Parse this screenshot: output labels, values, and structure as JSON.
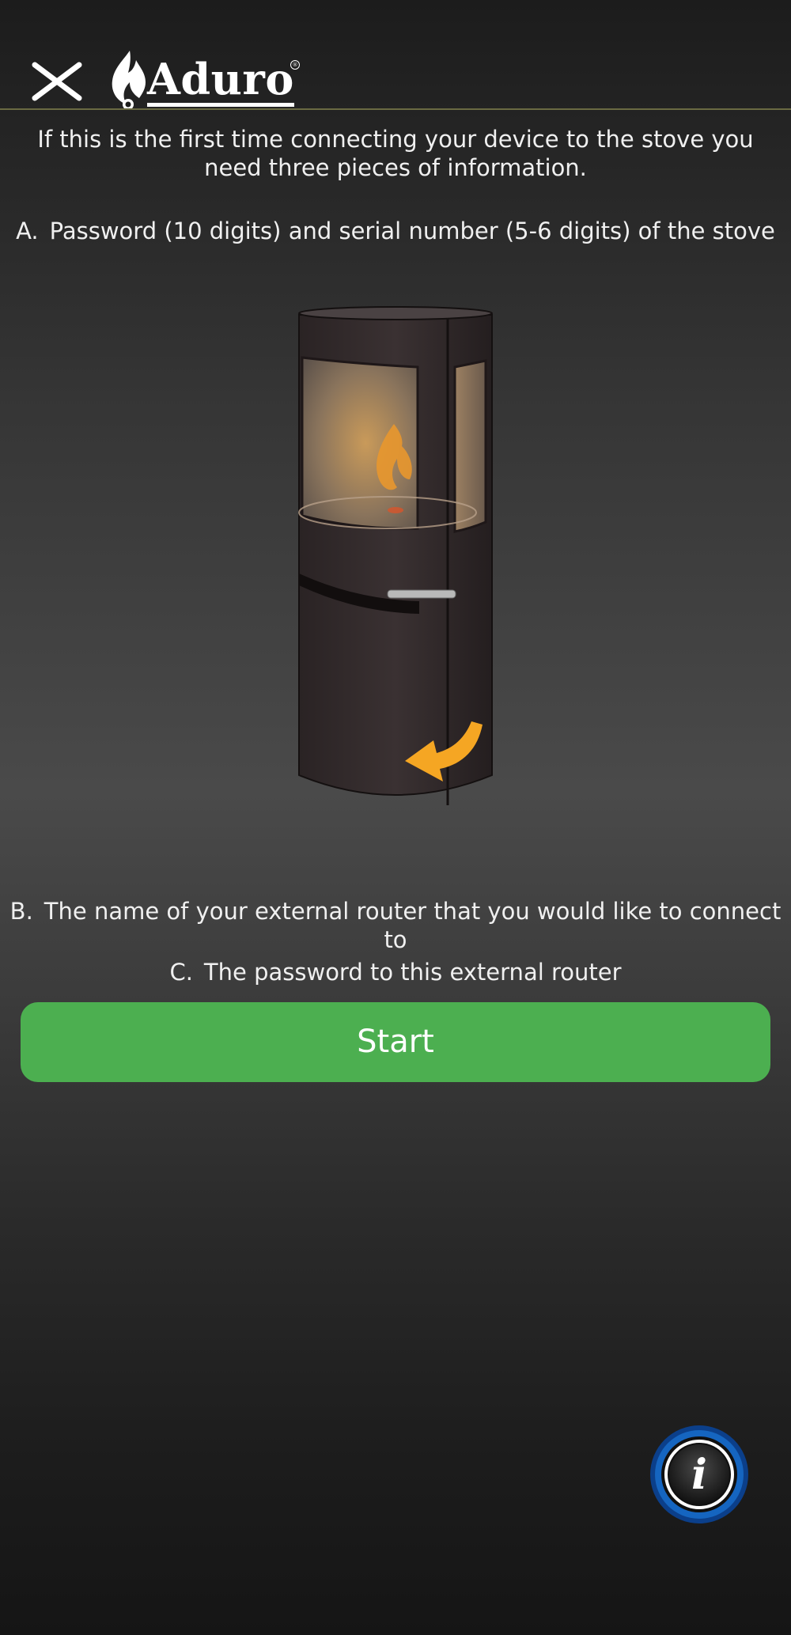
{
  "header": {
    "close_icon": "close-icon",
    "brand": "Aduro",
    "brand_mark": "®"
  },
  "intro_text": "If this is the first time connecting your device to the stove you need three pieces of information.",
  "items": [
    {
      "prefix": "A.",
      "text": "Password (10 digits) and serial number (5-6 digits) of the stove"
    },
    {
      "prefix": "B.",
      "text": "The name of your external router that you would like to connect to"
    },
    {
      "prefix": "C.",
      "text": "The password to this external router"
    }
  ],
  "start_button": {
    "label": "Start",
    "color": "#4caf50"
  },
  "info_button": {
    "icon": "info-icon",
    "glyph": "i",
    "ring_color": "#1565c0"
  },
  "illustration": {
    "name": "stove-illustration",
    "arrow_color": "#f5a623"
  }
}
